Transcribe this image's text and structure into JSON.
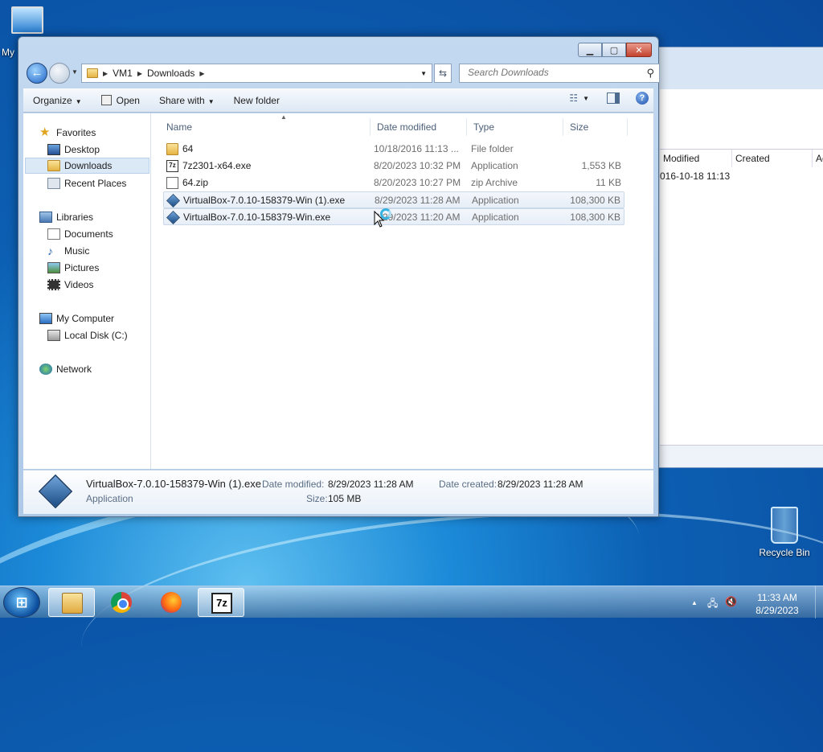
{
  "desktop": {
    "my_computer_label": "My",
    "recycle_bin_label": "Recycle Bin"
  },
  "background_window": {
    "headers": [
      "Modified",
      "Created",
      "Ac"
    ],
    "first_row_modified": "016-10-18 11:13"
  },
  "window": {
    "address": {
      "crumbs": [
        "VM1",
        "Downloads"
      ]
    },
    "search": {
      "placeholder": "Search Downloads"
    },
    "toolbar": {
      "organize": "Organize",
      "open": "Open",
      "share_with": "Share with",
      "new_folder": "New folder"
    },
    "nav": {
      "favorites": "Favorites",
      "desktop": "Desktop",
      "downloads": "Downloads",
      "recent_places": "Recent Places",
      "libraries": "Libraries",
      "documents": "Documents",
      "music": "Music",
      "pictures": "Pictures",
      "videos": "Videos",
      "my_computer": "My Computer",
      "local_disk": "Local Disk (C:)",
      "network": "Network"
    },
    "columns": [
      "Name",
      "Date modified",
      "Type",
      "Size"
    ],
    "files": [
      {
        "name": "64",
        "date": "10/18/2016 11:13 ...",
        "type": "File folder",
        "size": "",
        "icon": "folder-icon"
      },
      {
        "name": "7z2301-x64.exe",
        "date": "8/20/2023 10:32 PM",
        "type": "Application",
        "size": "1,553 KB",
        "icon": "7zip-exe-icon"
      },
      {
        "name": "64.zip",
        "date": "8/20/2023 10:27 PM",
        "type": "zip Archive",
        "size": "11 KB",
        "icon": "zip-file-icon"
      },
      {
        "name": "VirtualBox-7.0.10-158379-Win (1).exe",
        "date": "8/29/2023 11:28 AM",
        "type": "Application",
        "size": "108,300 KB",
        "icon": "virtualbox-icon"
      },
      {
        "name": "VirtualBox-7.0.10-158379-Win.exe",
        "date": "8/29/2023 11:20 AM",
        "type": "Application",
        "size": "108,300 KB",
        "icon": "virtualbox-icon"
      }
    ],
    "details": {
      "filename": "VirtualBox-7.0.10-158379-Win (1).exe",
      "type": "Application",
      "date_modified_label": "Date modified:",
      "date_modified": "8/29/2023 11:28 AM",
      "date_created_label": "Date created:",
      "date_created": "8/29/2023 11:28 AM",
      "size_label": "Size:",
      "size": "105 MB"
    }
  },
  "taskbar": {
    "start_label": "Start",
    "apps": [
      "windows-explorer",
      "google-chrome",
      "firefox",
      "7-zip"
    ],
    "sevenzip_glyph": "7z",
    "clock_time": "11:33 AM",
    "clock_date": "8/29/2023"
  }
}
